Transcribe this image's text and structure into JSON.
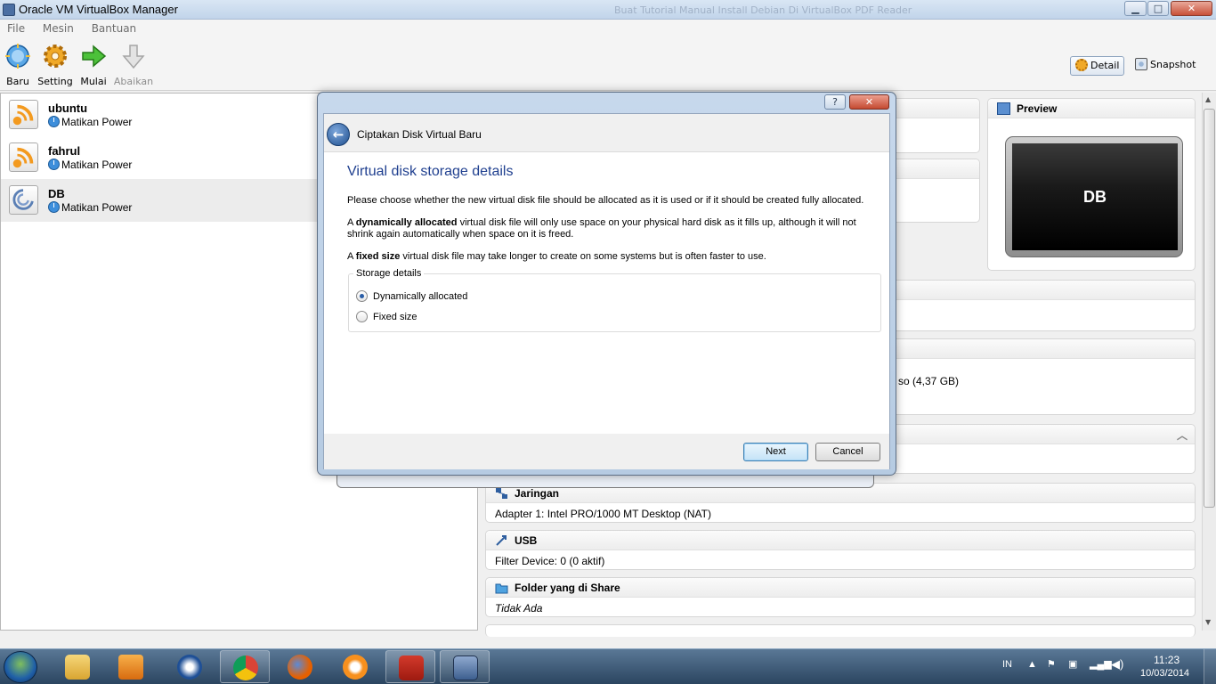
{
  "window": {
    "title": "Oracle VM VirtualBox Manager",
    "ghost_title": "Buat Tutorial Manual Install Debian Di VirtualBox PDF Reader",
    "controls": {
      "minimize": "▁",
      "maximize": "□",
      "close": "✕"
    }
  },
  "menu": [
    "File",
    "Mesin",
    "Bantuan"
  ],
  "toolbar": {
    "new_label": "Baru",
    "settings_label": "Setting",
    "start_label": "Mulai",
    "discard_label": "Abaikan",
    "detail_label": "Detail",
    "snapshot_label": "Snapshot"
  },
  "vms": [
    {
      "name": "ubuntu",
      "state": "Matikan Power"
    },
    {
      "name": "fahrul",
      "state": "Matikan Power"
    },
    {
      "name": "DB",
      "state": "Matikan Power"
    }
  ],
  "details": {
    "preview_header": "Preview",
    "preview_name": "DB",
    "storage_partial": "so (4,37 GB)",
    "network_header": "Jaringan",
    "network_value": "Adapter 1:  Intel PRO/1000 MT Desktop (NAT)",
    "usb_header": "USB",
    "usb_value": "Filter Device:  0 (0 aktif)",
    "shared_header": "Folder yang di Share",
    "shared_value": "Tidak Ada"
  },
  "dialog": {
    "help_btn": "?",
    "close_btn": "✕",
    "back_arrow": "←",
    "wizard_title": "Ciptakan Disk Virtual Baru",
    "page_title": "Virtual disk storage details",
    "intro": "Please choose whether the new virtual disk file should be allocated as it is used or if it should be created fully allocated.",
    "dyn_prefix": "A ",
    "dyn_bold": "dynamically allocated",
    "dyn_rest": " virtual disk file will only use space on your physical hard disk as it fills up, although it will not shrink again automatically when space on it is freed.",
    "fixed_prefix": "A ",
    "fixed_bold": "fixed size",
    "fixed_rest": " virtual disk file may take longer to create on some systems but is often faster to use.",
    "group_label": "Storage details",
    "option_dynamic": "Dynamically allocated",
    "option_fixed": "Fixed size",
    "selected": "dynamic",
    "next_label": "Next",
    "cancel_label": "Cancel"
  },
  "taskbar": {
    "lang": "IN",
    "time": "11:23",
    "date": "10/03/2014"
  }
}
